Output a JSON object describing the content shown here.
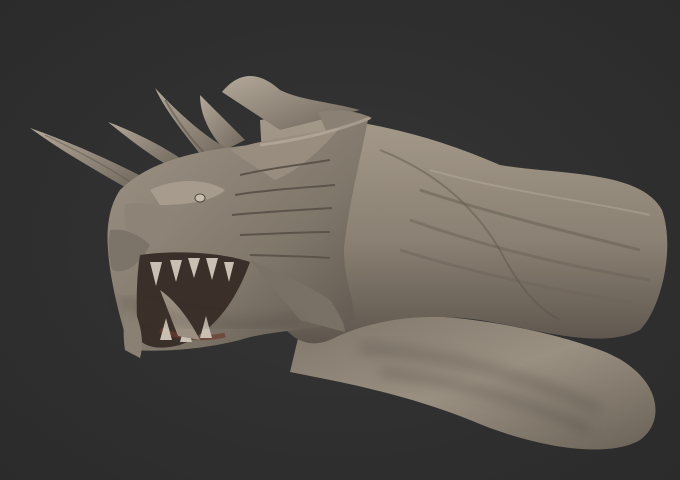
{
  "viewport": {
    "background_color": "#303030",
    "sculpt_color": "#8f8578",
    "shadow_color": "#3a342e",
    "highlight_color": "#b9ae9f"
  },
  "model": {
    "subject_icon": "dragon-head-sculpt-icon"
  }
}
